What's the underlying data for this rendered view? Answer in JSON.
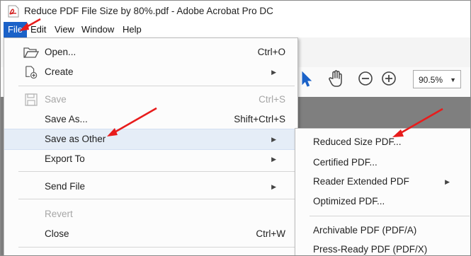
{
  "window": {
    "title": "Reduce PDF File Size by 80%.pdf - Adobe Acrobat Pro DC"
  },
  "menubar": {
    "items": [
      "File",
      "Edit",
      "View",
      "Window",
      "Help"
    ]
  },
  "toolbar": {
    "zoom": "90.5%"
  },
  "file_menu": {
    "items": [
      {
        "label": "Open...",
        "shortcut": "Ctrl+O",
        "icon": "open-folder-icon"
      },
      {
        "label": "Create",
        "submenu": true,
        "icon": "create-pdf-icon"
      },
      {
        "label": "Save",
        "shortcut": "Ctrl+S",
        "disabled": true,
        "icon": "save-disk-icon"
      },
      {
        "label": "Save As...",
        "shortcut": "Shift+Ctrl+S"
      },
      {
        "label": "Save as Other",
        "submenu": true,
        "highlighted": true
      },
      {
        "label": "Export To",
        "submenu": true
      },
      {
        "label": "Send File",
        "submenu": true
      },
      {
        "label": "Revert",
        "disabled": true
      },
      {
        "label": "Close",
        "shortcut": "Ctrl+W"
      }
    ]
  },
  "save_as_other_menu": {
    "items": [
      {
        "label": "Reduced Size PDF..."
      },
      {
        "label": "Certified PDF..."
      },
      {
        "label": "Reader Extended PDF",
        "submenu": true
      },
      {
        "label": "Optimized PDF..."
      },
      {
        "label": "Archivable PDF (PDF/A)"
      },
      {
        "label": "Press-Ready PDF (PDF/X)"
      }
    ]
  },
  "annotation_color": "#e81c1c"
}
